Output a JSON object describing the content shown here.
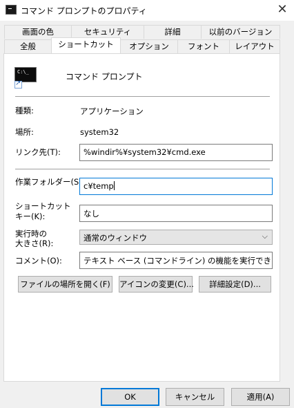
{
  "window": {
    "title": "コマンド プロンプトのプロパティ",
    "close_glyph": "✕"
  },
  "tabs_back": [
    "画面の色",
    "セキュリティ",
    "詳細",
    "以前のバージョン"
  ],
  "tabs_front": [
    "全般",
    "ショートカット",
    "オプション",
    "フォント",
    "レイアウト"
  ],
  "active_tab": "ショートカット",
  "app": {
    "icon": "cmd-icon",
    "icon_text": "C:\\_",
    "name": "コマンド プロンプト"
  },
  "fields": {
    "type_label": "種類:",
    "type_value": "アプリケーション",
    "location_label": "場所:",
    "location_value": "system32",
    "target_label": "リンク先(T):",
    "target_value": "%windir%¥system32¥cmd.exe",
    "workdir_label": "作業フォルダー(S):",
    "workdir_value": "c¥temp",
    "hotkey_label_1": "ショートカット",
    "hotkey_label_2": "キー(K):",
    "hotkey_value": "なし",
    "run_label_1": "実行時の",
    "run_label_2": "大きさ(R):",
    "run_value": "通常のウィンドウ",
    "comment_label": "コメント(O):",
    "comment_value": "テキスト ベース (コマンドライン) の機能を実行できます。"
  },
  "panel_buttons": {
    "open_location": "ファイルの場所を開く(F)",
    "change_icon": "アイコンの変更(C)...",
    "advanced": "詳細設定(D)..."
  },
  "dialog_buttons": {
    "ok": "OK",
    "cancel": "キャンセル",
    "apply": "適用(A)"
  },
  "colors": {
    "focus_border": "#0078d7",
    "panel_bg": "#ffffff",
    "dialog_bg": "#f0f0f0"
  }
}
